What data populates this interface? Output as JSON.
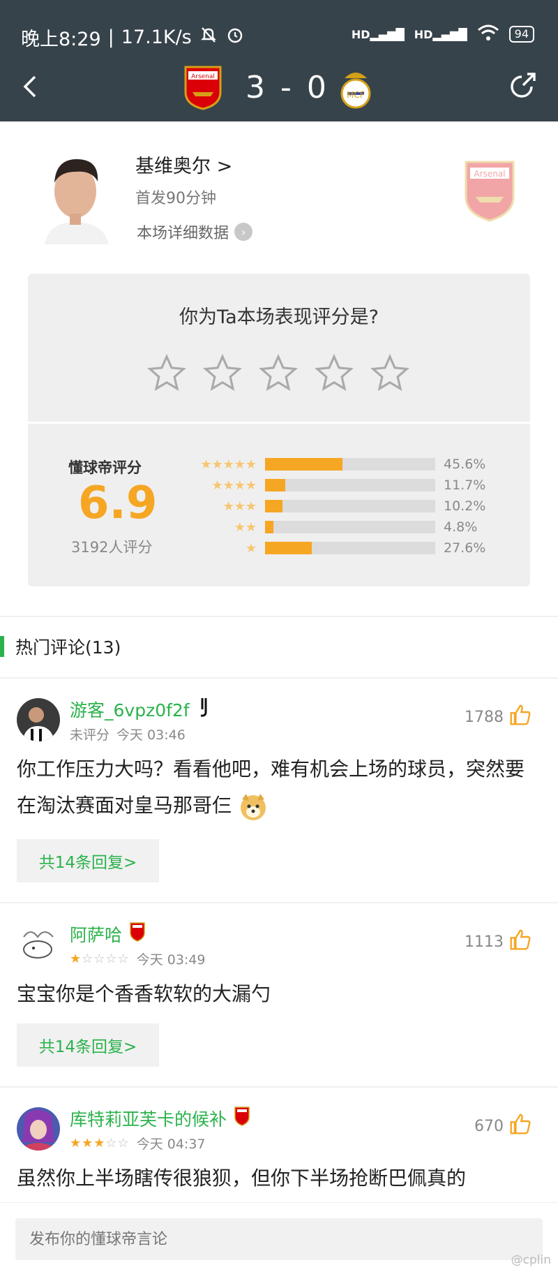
{
  "status_bar": {
    "time": "晚上8:29",
    "speed": "17.1K/s",
    "signal1": "HD",
    "signal2": "HD",
    "battery": "94"
  },
  "match": {
    "score": "3 - 0",
    "home_badge": "Arsenal",
    "away_badge": "Real Madrid",
    "home_name": "Arsenal",
    "away_name": ""
  },
  "player": {
    "name": "基维奥尔",
    "name_arrow": ">",
    "start_info": "首发90分钟",
    "detail_link": "本场详细数据",
    "club_badge": "Arsenal"
  },
  "rating": {
    "question": "你为Ta本场表现评分是?",
    "label": "懂球帝评分",
    "score": "6.9",
    "count": "3192人评分",
    "distribution": [
      {
        "stars": 5,
        "percent": 45.6,
        "label": "45.6%"
      },
      {
        "stars": 4,
        "percent": 11.7,
        "label": "11.7%"
      },
      {
        "stars": 3,
        "percent": 10.2,
        "label": "10.2%"
      },
      {
        "stars": 2,
        "percent": 4.8,
        "label": "4.8%"
      },
      {
        "stars": 1,
        "percent": 27.6,
        "label": "27.6%"
      }
    ]
  },
  "comments_section": {
    "title": "热门评论(13)"
  },
  "comments": [
    {
      "user": "游客_6vpz0f2f",
      "badge": "Juventus",
      "rating_text": "未评分",
      "time": "今天 03:46",
      "likes": "1788",
      "text": "你工作压力大吗？看看他吧，难有机会上场的球员，突然要在淘汰赛面对皇马那哥仨",
      "reply": "共14条回复>"
    },
    {
      "user": "阿萨哈",
      "badge": "Arsenal",
      "stars": 1,
      "time": "今天 03:49",
      "likes": "1113",
      "text": "宝宝你是个香香软软的大漏勺",
      "reply": "共14条回复>"
    },
    {
      "user": "库特莉亚芙卡的候补",
      "badge": "Arsenal",
      "stars": 3,
      "time": "今天 04:37",
      "likes": "670",
      "text": "虽然你上半场瞎传很狼狈，但你下半场抢断巴佩真的"
    }
  ],
  "footer": {
    "input_placeholder": "发布你的懂球帝言论",
    "watermark": "@cplin"
  },
  "colors": {
    "header_bg": "#37434b",
    "accent_green": "#2bb24c",
    "rating_orange": "#f5a623",
    "star_light": "#f7c66f"
  }
}
